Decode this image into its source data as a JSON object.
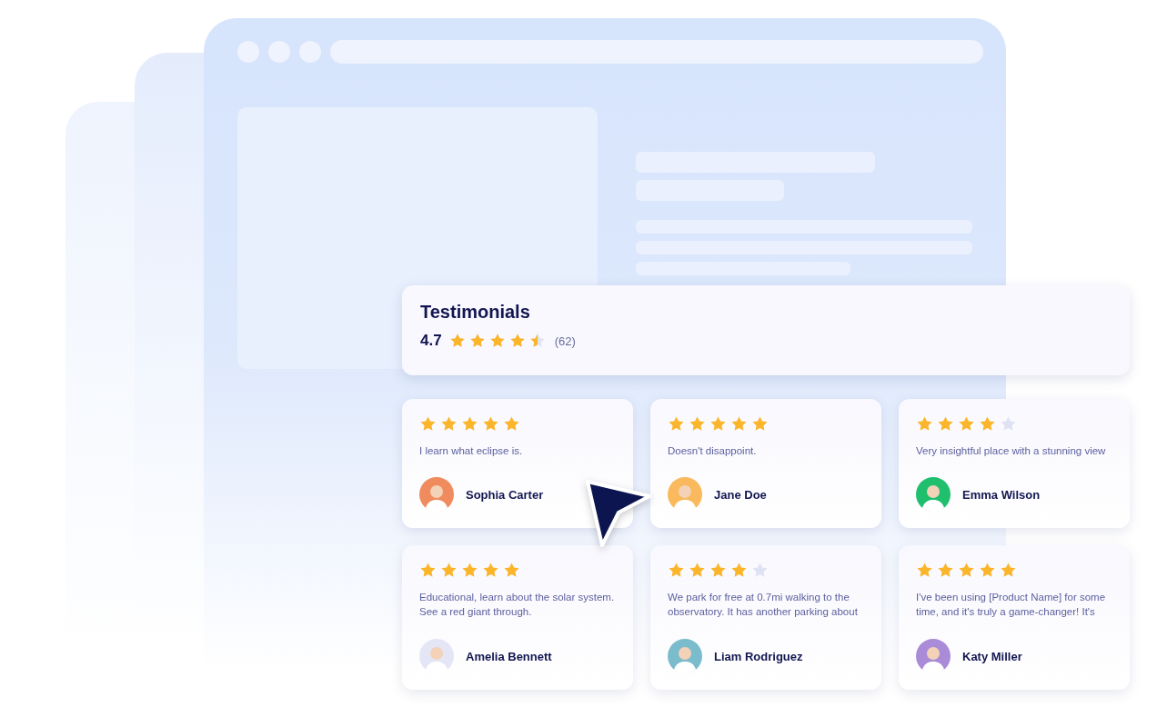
{
  "testimonials": {
    "title": "Testimonials",
    "rating": "4.7",
    "stars": 4.5,
    "count": "(62)"
  },
  "reviews": [
    {
      "stars": 5,
      "text": "I learn what eclipse is.",
      "name": "Sophia Carter",
      "color": "#f08b5e"
    },
    {
      "stars": 5,
      "text": "Doesn't disappoint.",
      "name": "Jane Doe",
      "color": "#f9b95c"
    },
    {
      "stars": 4,
      "text": "Very insightful place with a stunning view",
      "name": "Emma Wilson",
      "color": "#1fbf6e"
    },
    {
      "stars": 5,
      "text": "Educational, learn about the solar system. See a red giant through.",
      "name": "Amelia Bennett",
      "color": "#e4e6f6"
    },
    {
      "stars": 4,
      "text": "We park for free at 0.7mi walking to the observatory. It has another parking about",
      "name": "Liam Rodriguez",
      "color": "#7bbccc"
    },
    {
      "stars": 5,
      "text": "I've been using [Product Name] for some time, and it's truly a game-changer! It's",
      "name": "Katy Miller",
      "color": "#a98bd8"
    }
  ]
}
